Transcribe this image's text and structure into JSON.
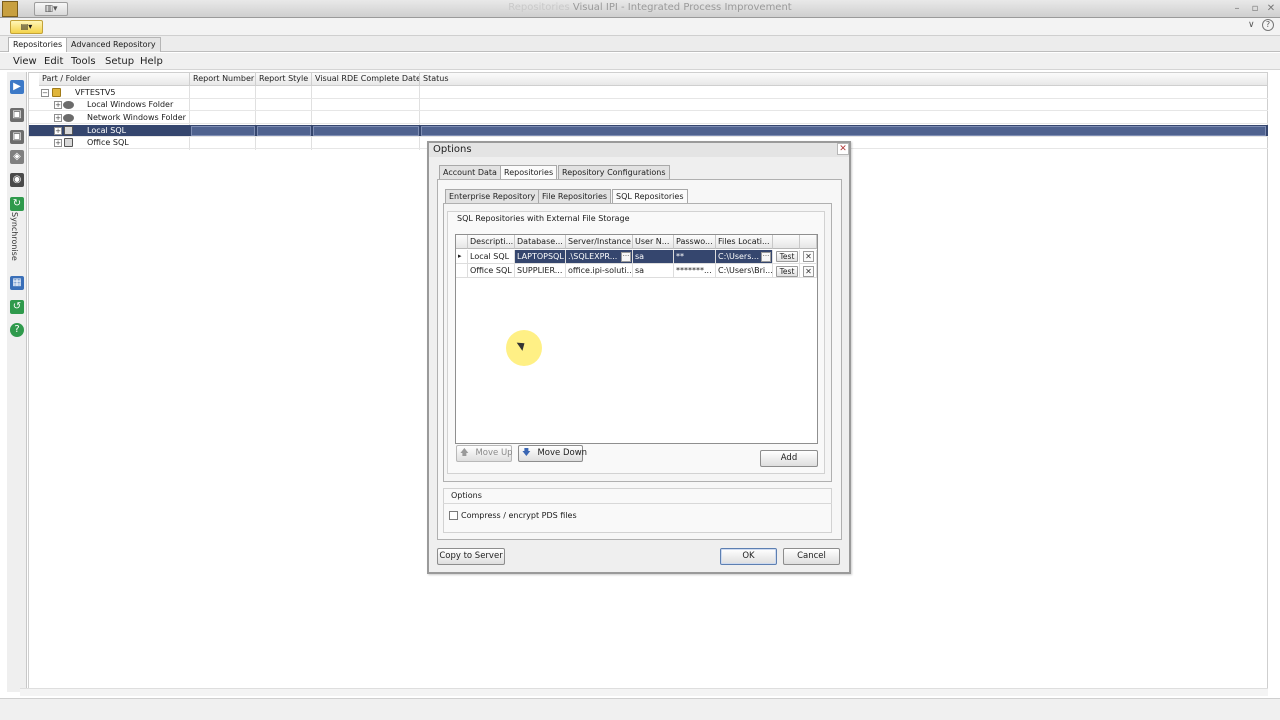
{
  "window": {
    "title": "Visual IPI - Integrated Process Improvement",
    "title_prefix_blurred": "Repositories",
    "qat_label": "▥▾",
    "ribbon_button": "▤▾",
    "min_glyph": "–",
    "max_glyph": "▫",
    "close_glyph": "✕",
    "ribbon_collapse": "∨",
    "ribbon_help": "?"
  },
  "doc_tabs": [
    {
      "label": "Repositories",
      "active": true
    },
    {
      "label": "Advanced Repository",
      "active": false
    }
  ],
  "menu": [
    "View",
    "Edit",
    "Tools",
    "Setup",
    "Help"
  ],
  "left_toolbar": {
    "sync_label": "Synchronise",
    "icons": [
      "play-icon",
      "page-icon",
      "page-add-icon",
      "page-save-icon",
      "tag-icon",
      "binoculars-icon",
      "sync-icon",
      "grid-icon",
      "refresh-icon",
      "help-icon"
    ]
  },
  "tree": {
    "columns": [
      "Part / Folder",
      "Report Number",
      "Report Style",
      "Visual RDE Complete Date",
      "Status"
    ],
    "rows": [
      {
        "label": "VFTESTV5",
        "expander": "−",
        "icon": "database-root-icon",
        "selected": false
      },
      {
        "label": "Local Windows Folder",
        "expander": "+",
        "icon": "folder-link-icon",
        "selected": false
      },
      {
        "label": "Network Windows Folder",
        "expander": "+",
        "icon": "folder-link-icon",
        "selected": false
      },
      {
        "label": "Local SQL",
        "expander": "+",
        "icon": "sql-db-icon",
        "selected": true
      },
      {
        "label": "Office SQL",
        "expander": "+",
        "icon": "sql-db-icon",
        "selected": false
      }
    ]
  },
  "dialog": {
    "title": "Options",
    "close_glyph": "✕",
    "top_tabs": [
      {
        "label": "Account Data",
        "active": false
      },
      {
        "label": "Repositories",
        "active": true
      },
      {
        "label": "Repository Configurations",
        "active": false
      }
    ],
    "sub_tabs": [
      {
        "label": "Enterprise Repository",
        "active": false
      },
      {
        "label": "File Repositories",
        "active": false
      },
      {
        "label": "SQL Repositories",
        "active": true
      }
    ],
    "group_title": "SQL Repositories with External File Storage",
    "grid": {
      "columns": [
        "Descripti...",
        "Database...",
        "Server/Instance",
        "User N...",
        "Passwo...",
        "Files Locati..."
      ],
      "rows": [
        {
          "description": "Local SQL",
          "database": "LAPTOPSQL",
          "server": ".\\SQLEXPR...",
          "user": "sa",
          "password": "**",
          "files": "C:\\Users...",
          "selected": true
        },
        {
          "description": "Office SQL",
          "database": "SUPPLIER...",
          "server": "office.ipi-soluti...",
          "user": "sa",
          "password": "*******...",
          "files": "C:\\Users\\Bri...",
          "selected": false
        }
      ],
      "ellipsis": "···",
      "test_label": "Test",
      "delete_glyph": "✕",
      "row_pointer": "▸"
    },
    "move_up": "Move Up",
    "move_down": "Move Down",
    "add": "Add",
    "options_group": "Options",
    "compress_label": "Compress / encrypt PDS files",
    "compress_checked": false,
    "copy_to_server": "Copy to Server",
    "ok": "OK",
    "cancel": "Cancel"
  }
}
